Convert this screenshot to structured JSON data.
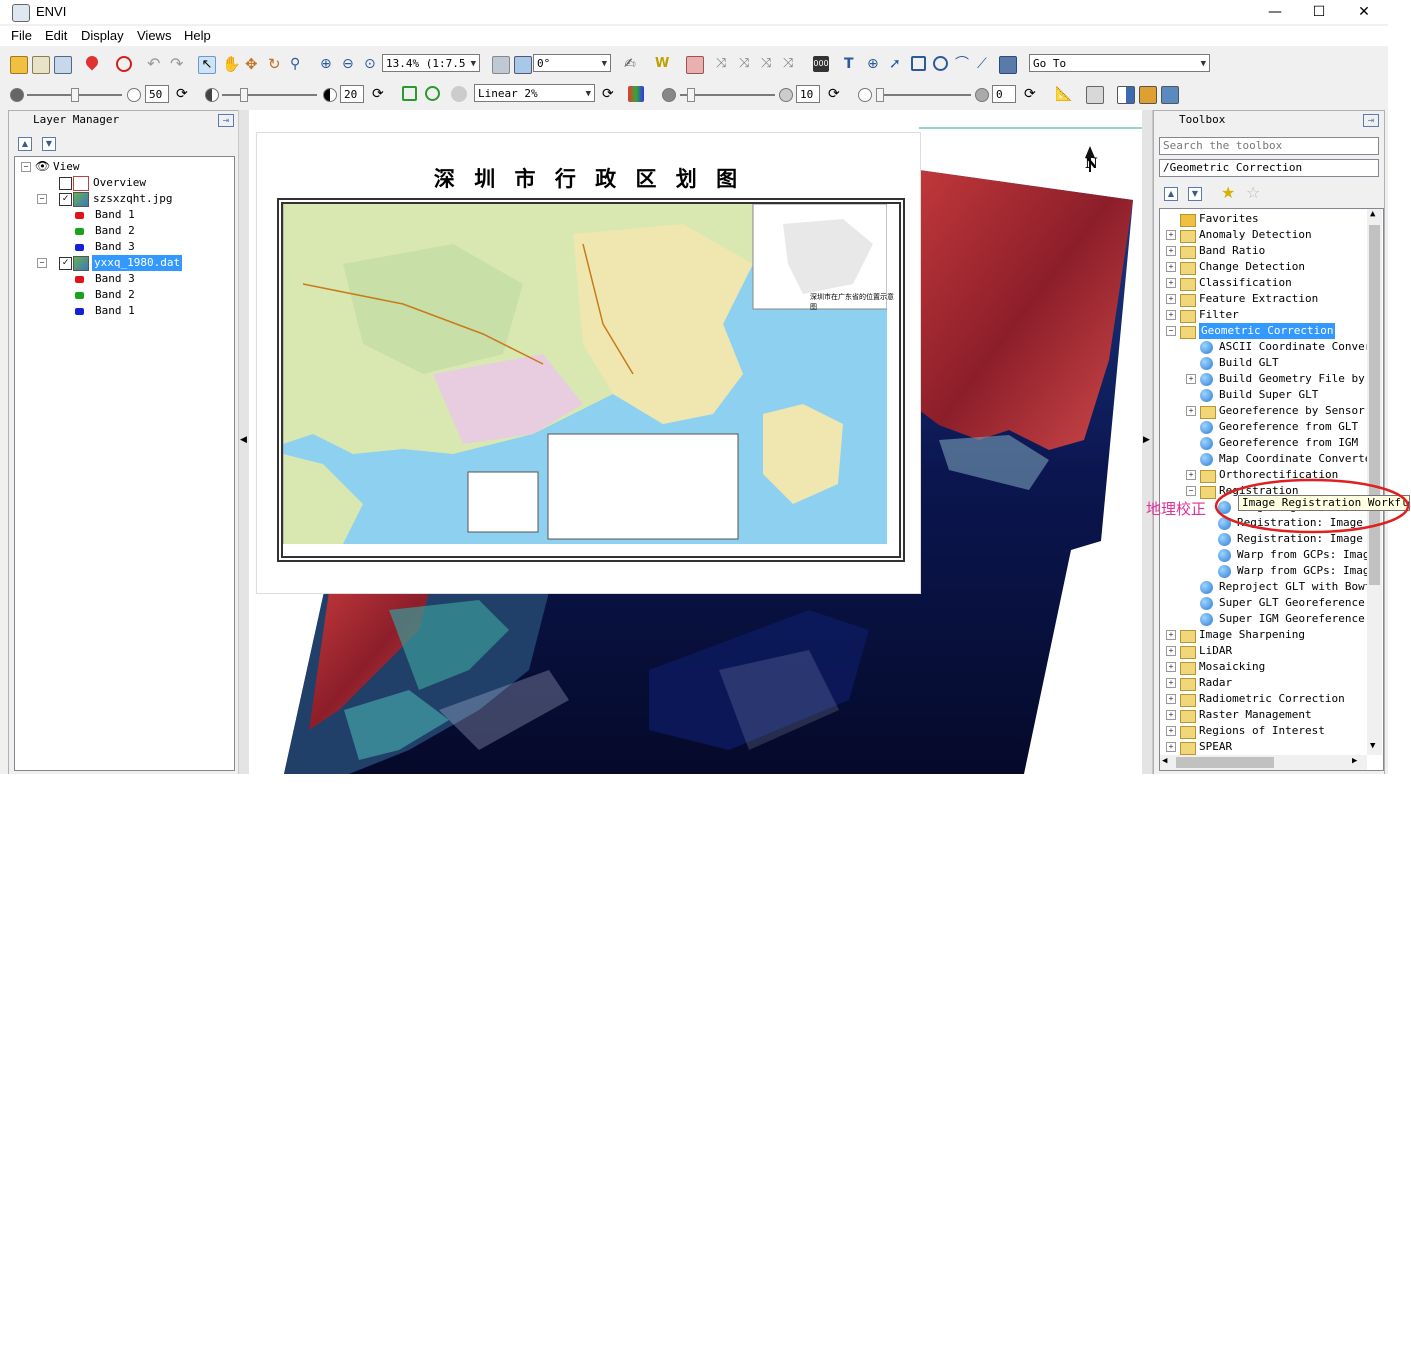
{
  "window": {
    "title": "ENVI",
    "minimize": "—",
    "maximize": "☐",
    "close": "✕"
  },
  "menu": [
    "File",
    "Edit",
    "Display",
    "Views",
    "Help"
  ],
  "toolbar1": {
    "zoom_value": "13.4% (1:7.5",
    "rotation": "0°",
    "goto": "Go To"
  },
  "toolbar2": {
    "brightness": "50",
    "contrast": "20",
    "stretch": "Linear 2%",
    "sharpen": "10",
    "transparency": "0"
  },
  "layer_manager": {
    "title": "Layer Manager",
    "items": [
      {
        "label": "View",
        "level": 0
      },
      {
        "label": "Overview",
        "level": 1
      },
      {
        "label": "szsxzqht.jpg",
        "level": 1
      },
      {
        "label": "Band 1",
        "level": 2,
        "color": "#e0131b"
      },
      {
        "label": "Band 2",
        "level": 2,
        "color": "#18a31d"
      },
      {
        "label": "Band 3",
        "level": 2,
        "color": "#1520d6"
      },
      {
        "label": "yxxq_1980.dat",
        "level": 1
      },
      {
        "label": "Band 3",
        "level": 2,
        "color": "#e0131b"
      },
      {
        "label": "Band 2",
        "level": 2,
        "color": "#18a31d"
      },
      {
        "label": "Band 1",
        "level": 2,
        "color": "#1520d6"
      }
    ]
  },
  "map": {
    "title": "深 圳 市 行 政 区 划 图",
    "inset_caption": "深圳市在广东省的位置示意图",
    "north": "N"
  },
  "toolbox": {
    "title": "Toolbox",
    "search_placeholder": "Search the toolbox",
    "path": "/Geometric Correction",
    "items": [
      {
        "label": "Favorites",
        "level": 0,
        "type": "folder",
        "exp": ""
      },
      {
        "label": "Anomaly Detection",
        "level": 0,
        "type": "folder",
        "exp": "+"
      },
      {
        "label": "Band Ratio",
        "level": 0,
        "type": "folder",
        "exp": "+"
      },
      {
        "label": "Change Detection",
        "level": 0,
        "type": "folder",
        "exp": "+"
      },
      {
        "label": "Classification",
        "level": 0,
        "type": "folder",
        "exp": "+"
      },
      {
        "label": "Feature Extraction",
        "level": 0,
        "type": "folder",
        "exp": "+"
      },
      {
        "label": "Filter",
        "level": 0,
        "type": "folder",
        "exp": "+"
      },
      {
        "label": "Geometric Correction",
        "level": 0,
        "type": "folder",
        "exp": "−",
        "selected": true
      },
      {
        "label": "ASCII Coordinate Conver",
        "level": 1,
        "type": "tool",
        "exp": ""
      },
      {
        "label": "Build GLT",
        "level": 1,
        "type": "tool",
        "exp": ""
      },
      {
        "label": "Build Geometry File by S",
        "level": 1,
        "type": "tool",
        "exp": "+"
      },
      {
        "label": "Build Super GLT",
        "level": 1,
        "type": "tool",
        "exp": ""
      },
      {
        "label": "Georeference by Sensor",
        "level": 1,
        "type": "folder",
        "exp": "+"
      },
      {
        "label": "Georeference from GLT",
        "level": 1,
        "type": "tool",
        "exp": ""
      },
      {
        "label": "Georeference from IGM",
        "level": 1,
        "type": "tool",
        "exp": ""
      },
      {
        "label": "Map Coordinate Converte",
        "level": 1,
        "type": "tool",
        "exp": ""
      },
      {
        "label": "Orthorectification",
        "level": 1,
        "type": "folder",
        "exp": "+"
      },
      {
        "label": "Registration",
        "level": 1,
        "type": "folder",
        "exp": "−"
      },
      {
        "label": "Image Registration Workflow",
        "level": 2,
        "type": "tool",
        "exp": ""
      },
      {
        "label": "Registration: Image",
        "level": 2,
        "type": "tool",
        "exp": ""
      },
      {
        "label": "Registration: Image",
        "level": 2,
        "type": "tool",
        "exp": ""
      },
      {
        "label": "Warp from GCPs: Imag",
        "level": 2,
        "type": "tool",
        "exp": ""
      },
      {
        "label": "Warp from GCPs: Imag",
        "level": 2,
        "type": "tool",
        "exp": ""
      },
      {
        "label": "Reproject GLT with Bowt",
        "level": 1,
        "type": "tool",
        "exp": ""
      },
      {
        "label": "Super GLT Georeference",
        "level": 1,
        "type": "tool",
        "exp": ""
      },
      {
        "label": "Super IGM Georeference",
        "level": 1,
        "type": "tool",
        "exp": ""
      },
      {
        "label": "Image Sharpening",
        "level": 0,
        "type": "folder",
        "exp": "+"
      },
      {
        "label": "LiDAR",
        "level": 0,
        "type": "folder",
        "exp": "+"
      },
      {
        "label": "Mosaicking",
        "level": 0,
        "type": "folder",
        "exp": "+"
      },
      {
        "label": "Radar",
        "level": 0,
        "type": "folder",
        "exp": "+"
      },
      {
        "label": "Radiometric Correction",
        "level": 0,
        "type": "folder",
        "exp": "+"
      },
      {
        "label": "Raster Management",
        "level": 0,
        "type": "folder",
        "exp": "+"
      },
      {
        "label": "Regions of Interest",
        "level": 0,
        "type": "folder",
        "exp": "+"
      },
      {
        "label": "SPEAR",
        "level": 0,
        "type": "folder",
        "exp": "+"
      }
    ],
    "tooltip": "Image Registration Workflow"
  },
  "annotation": {
    "text": "地理校正",
    "color": "#e0309a"
  }
}
